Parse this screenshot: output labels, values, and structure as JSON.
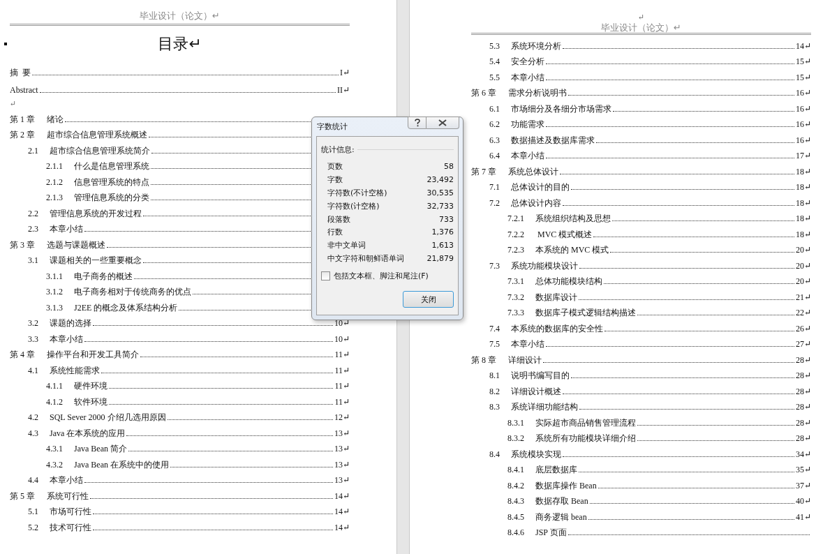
{
  "left_page": {
    "header": "毕业设计（论文）↵",
    "title": "目录↵",
    "front_matter": [
      {
        "title": "摘  要",
        "page": "I↵"
      },
      {
        "title": "Abstract",
        "page": "II↵"
      }
    ],
    "blank_mark": "↵",
    "chapters": [
      {
        "number": "第 1 章",
        "title": "绪论"
      },
      {
        "number": "第 2 章",
        "title": "超市综合信息管理系统概述",
        "children": [
          {
            "number": "2.1",
            "title": "超市综合信息管理系统简介",
            "children": [
              {
                "number": "2.1.1",
                "title": "什么是信息管理系统"
              },
              {
                "number": "2.1.2",
                "title": "信息管理系统的特点"
              },
              {
                "number": "2.1.3",
                "title": "管理信息系统的分类"
              }
            ]
          },
          {
            "number": "2.2",
            "title": "管理信息系统的开发过程"
          },
          {
            "number": "2.3",
            "title": "本章小结"
          }
        ]
      },
      {
        "number": "第 3 章",
        "title": "选题与课题概述",
        "children": [
          {
            "number": "3.1",
            "title": "课题相关的一些重要概念",
            "children": [
              {
                "number": "3.1.1",
                "title": "电子商务的概述"
              },
              {
                "number": "3.1.2",
                "title": "电子商务相对于传统商务的优点"
              },
              {
                "number": "3.1.3",
                "title": "J2EE 的概念及体系结构分析"
              }
            ]
          },
          {
            "number": "3.2",
            "title": "课题的选择",
            "page": "10↵"
          },
          {
            "number": "3.3",
            "title": "本章小结",
            "page": "10↵"
          }
        ]
      },
      {
        "number": "第 4 章",
        "title": "操作平台和开发工具简介",
        "page": "11↵",
        "children": [
          {
            "number": "4.1",
            "title": "系统性能需求",
            "page": "11↵",
            "children": [
              {
                "number": "4.1.1",
                "title": "硬件环境",
                "page": "11↵"
              },
              {
                "number": "4.1.2",
                "title": "软件环境",
                "page": "11↵"
              }
            ]
          },
          {
            "number": "4.2",
            "title": "SQL Sever 2000 介绍几选用原因",
            "page": "12↵"
          },
          {
            "number": "4.3",
            "title": "Java 在本系统的应用",
            "page": "13↵",
            "children": [
              {
                "number": "4.3.1",
                "title": "Java Bean 简介",
                "page": "13↵"
              },
              {
                "number": "4.3.2",
                "title": "Java Bean 在系统中的使用",
                "page": "13↵"
              }
            ]
          },
          {
            "number": "4.4",
            "title": "本章小结",
            "page": "13↵"
          }
        ]
      },
      {
        "number": "第 5 章",
        "title": "系统可行性",
        "page": "14↵",
        "children": [
          {
            "number": "5.1",
            "title": "市场可行性",
            "page": "14↵"
          },
          {
            "number": "5.2",
            "title": "技术可行性",
            "page": "14↵"
          }
        ]
      }
    ]
  },
  "right_page": {
    "top_mark": "↵",
    "header": "毕业设计（论文）↵",
    "chapters": [
      {
        "children": [
          {
            "number": "5.3",
            "title": "系统环境分析",
            "page": "14↵"
          },
          {
            "number": "5.4",
            "title": "安全分析",
            "page": "15↵"
          },
          {
            "number": "5.5",
            "title": "本章小结",
            "page": "15↵"
          }
        ]
      },
      {
        "number": "第 6 章",
        "title": "需求分析说明书",
        "page": "16↵",
        "children": [
          {
            "number": "6.1",
            "title": "市场细分及各细分市场需求",
            "page": "16↵"
          },
          {
            "number": "6.2",
            "title": "功能需求",
            "page": "16↵"
          },
          {
            "number": "6.3",
            "title": "数据描述及数据库需求",
            "page": "16↵"
          },
          {
            "number": "6.4",
            "title": "本章小结",
            "page": "17↵"
          }
        ]
      },
      {
        "number": "第 7 章",
        "title": "系统总体设计",
        "page": "18↵",
        "children": [
          {
            "number": "7.1",
            "title": "总体设计的目的",
            "page": "18↵"
          },
          {
            "number": "7.2",
            "title": "总体设计内容",
            "page": "18↵",
            "children": [
              {
                "number": "7.2.1",
                "title": "系统组织结构及思想",
                "page": "18↵"
              },
              {
                "number": "7.2.2",
                "title": " MVC 模式概述",
                "page": "18↵"
              },
              {
                "number": "7.2.3",
                "title": "本系统的 MVC 模式",
                "page": "20↵"
              }
            ]
          },
          {
            "number": "7.3",
            "title": "系统功能模块设计",
            "page": "20↵",
            "children": [
              {
                "number": "7.3.1",
                "title": "总体功能模块结构",
                "page": "20↵"
              },
              {
                "number": "7.3.2",
                "title": "数据库设计",
                "page": "21↵"
              },
              {
                "number": "7.3.3",
                "title": "数据库子模式逻辑结构描述",
                "page": "22↵"
              }
            ]
          },
          {
            "number": "7.4",
            "title": "本系统的数据库的安全性",
            "page": "26↵"
          },
          {
            "number": "7.5",
            "title": "本章小结",
            "page": "27↵"
          }
        ]
      },
      {
        "number": "第 8 章",
        "title": "详细设计",
        "page": "28↵",
        "children": [
          {
            "number": "8.1",
            "title": "说明书编写目的",
            "page": "28↵"
          },
          {
            "number": "8.2",
            "title": "详细设计概述",
            "page": "28↵"
          },
          {
            "number": "8.3",
            "title": "系统详细功能结构",
            "page": "28↵",
            "children": [
              {
                "number": "8.3.1",
                "title": "实际超市商品销售管理流程",
                "page": "28↵"
              },
              {
                "number": "8.3.2",
                "title": "系统所有功能模块详细介绍",
                "page": "28↵"
              }
            ]
          },
          {
            "number": "8.4",
            "title": "系统模块实现",
            "page": "34↵",
            "children": [
              {
                "number": "8.4.1",
                "title": "底层数据库",
                "page": "35↵"
              },
              {
                "number": "8.4.2",
                "title": "数据库操作 Bean",
                "page": "37↵"
              },
              {
                "number": "8.4.3",
                "title": "数据存取 Bean",
                "page": "40↵"
              },
              {
                "number": "8.4.5",
                "title": "商务逻辑 bean",
                "page": "41↵"
              },
              {
                "number": "8.4.6",
                "title": "JSP 页面"
              }
            ]
          }
        ]
      }
    ]
  },
  "dialog": {
    "title": "字数统计",
    "section_label": "统计信息:",
    "stats": [
      {
        "label": "页数",
        "value": "58"
      },
      {
        "label": "字数",
        "value": "23,492"
      },
      {
        "label": "字符数(不计空格)",
        "value": "30,535"
      },
      {
        "label": "字符数(计空格)",
        "value": "32,733"
      },
      {
        "label": "段落数",
        "value": "733"
      },
      {
        "label": "行数",
        "value": "1,376"
      },
      {
        "label": "非中文单词",
        "value": "1,613"
      },
      {
        "label": "中文字符和朝鲜语单词",
        "value": "21,879"
      }
    ],
    "checkbox": {
      "label": "包括文本框、脚注和尾注(F)",
      "checked": false
    },
    "button": "关闭"
  }
}
